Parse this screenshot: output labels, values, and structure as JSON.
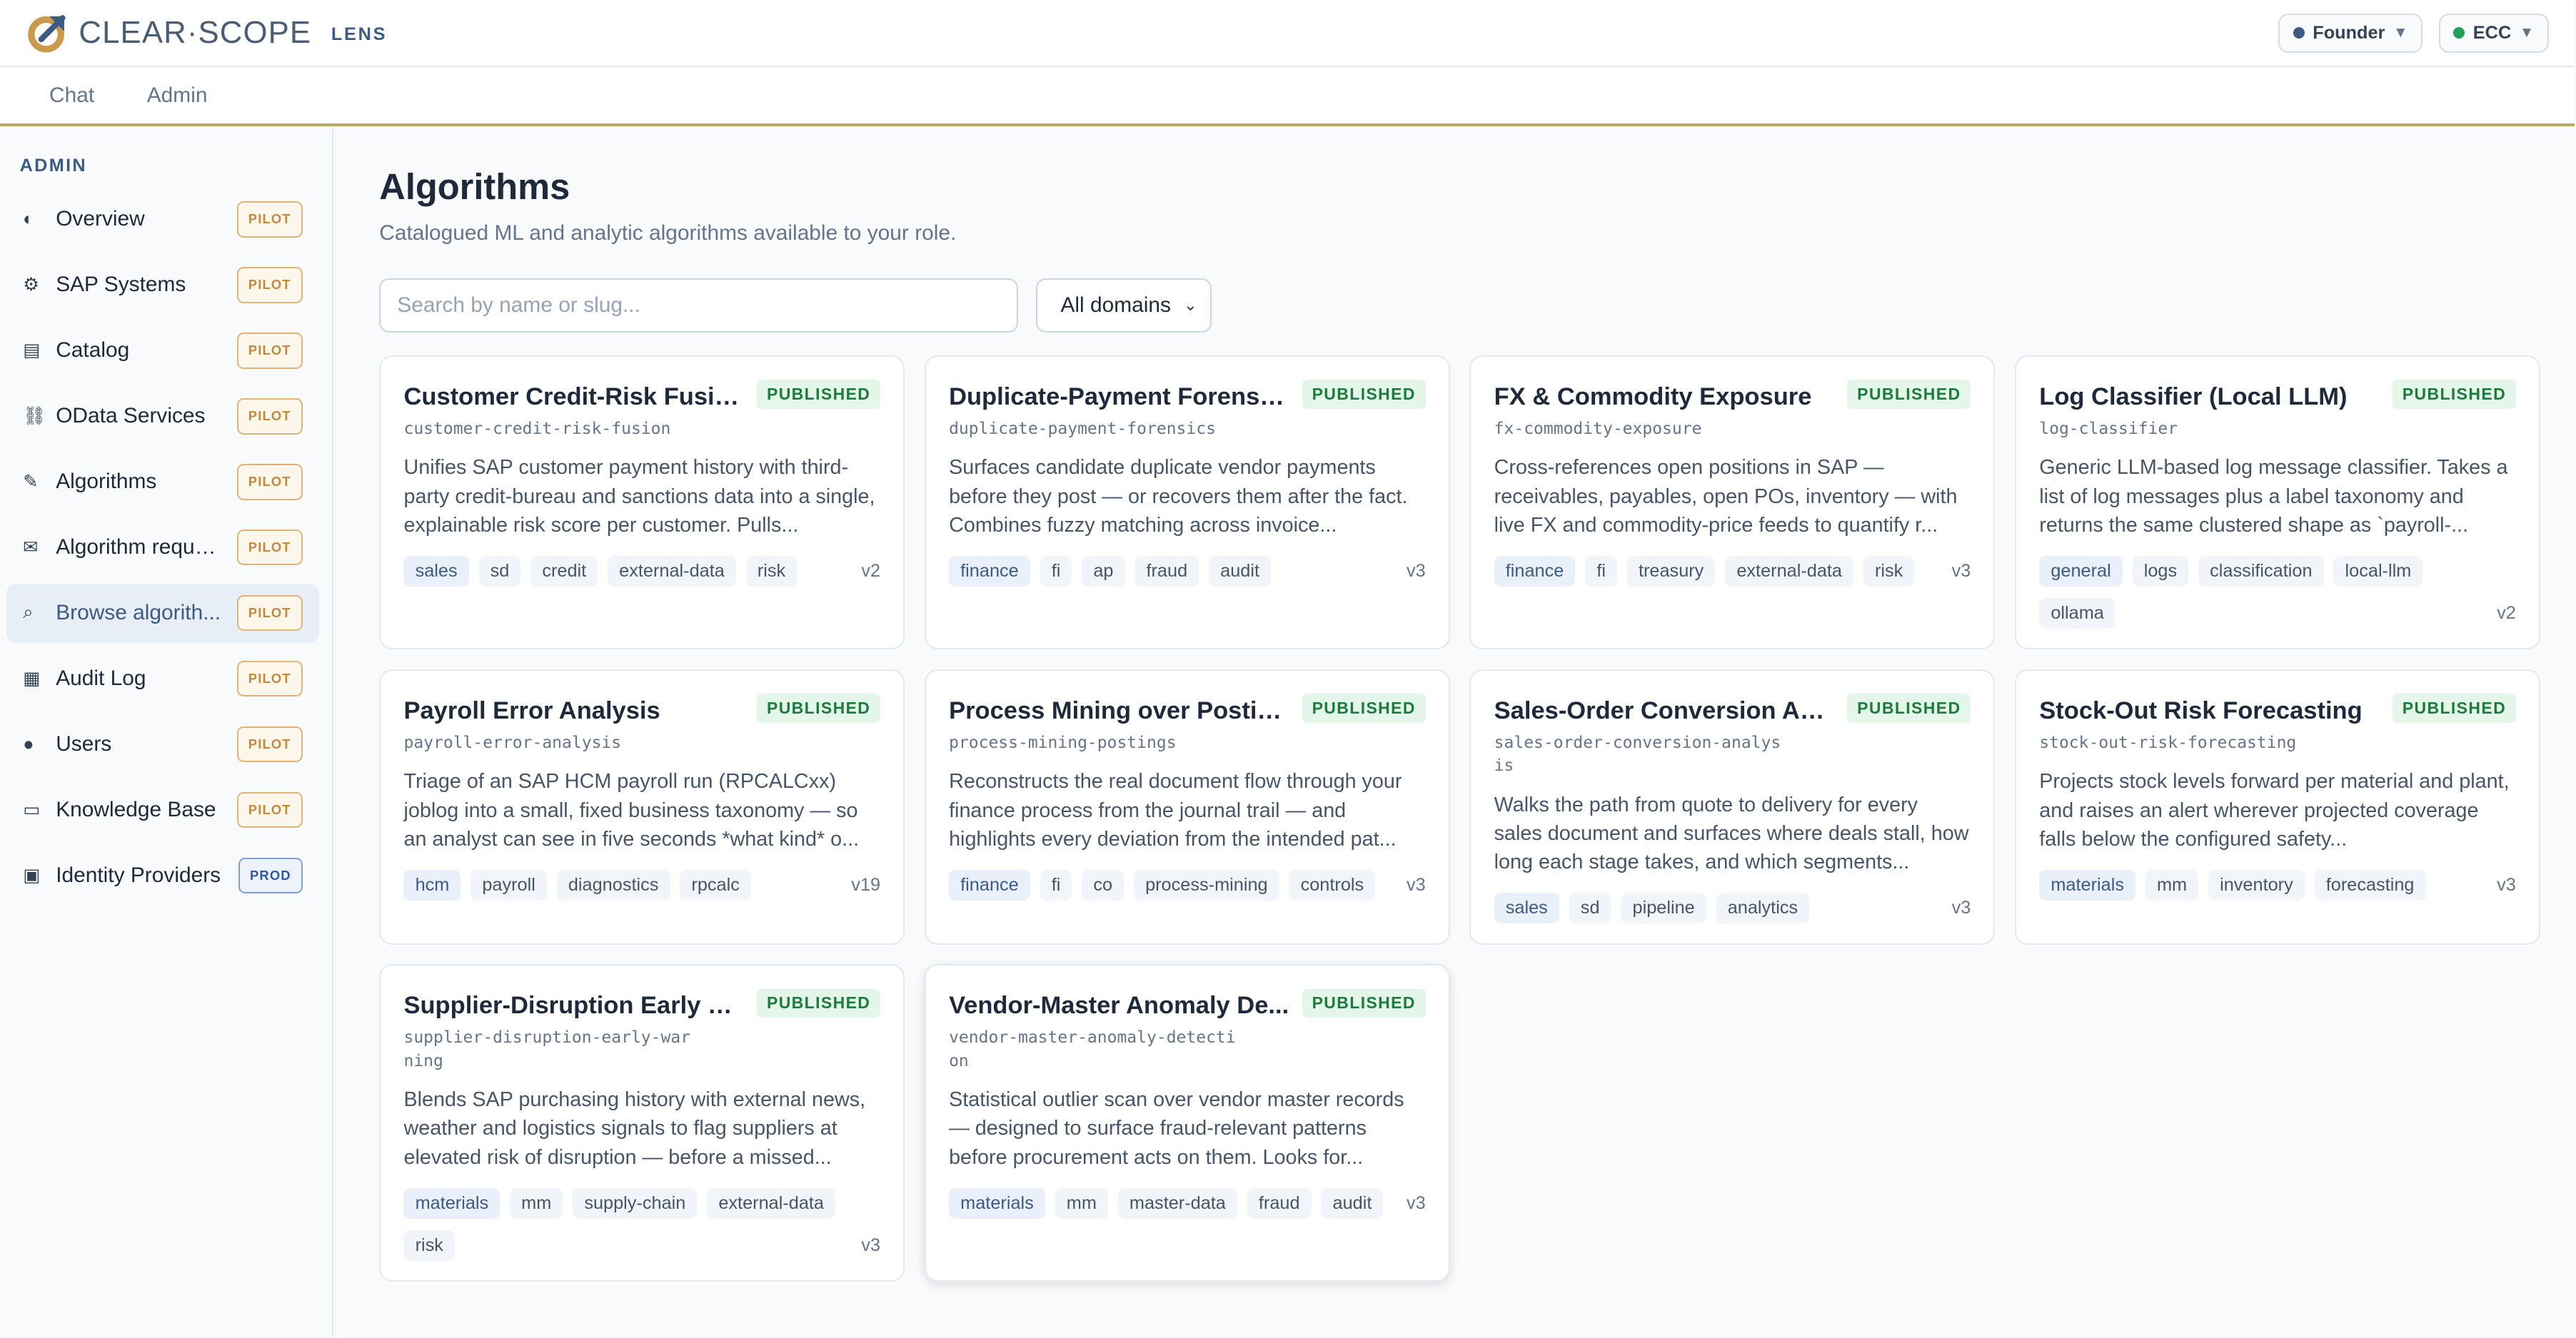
{
  "brand": {
    "name": "CLEAR·SCOPE",
    "product": "LENS"
  },
  "header": {
    "role": {
      "label": "Founder",
      "color": "#3b5b85"
    },
    "system": {
      "label": "ECC",
      "color": "#22a055"
    }
  },
  "topnav": {
    "items": [
      "Chat",
      "Admin"
    ]
  },
  "sidebar": {
    "heading": "ADMIN",
    "items": [
      {
        "label": "Overview",
        "icon": "half-circle-icon",
        "glyph": "◐",
        "badge": "PILOT"
      },
      {
        "label": "SAP Systems",
        "icon": "gear-icon",
        "glyph": "⚙",
        "badge": "PILOT"
      },
      {
        "label": "Catalog",
        "icon": "books-icon",
        "glyph": "▤",
        "badge": "PILOT"
      },
      {
        "label": "OData Services",
        "icon": "link-icon",
        "glyph": "⛓",
        "badge": "PILOT"
      },
      {
        "label": "Algorithms",
        "icon": "pencil-icon",
        "glyph": "✎",
        "badge": "PILOT"
      },
      {
        "label": "Algorithm reque...",
        "icon": "envelope-icon",
        "glyph": "✉",
        "badge": "PILOT"
      },
      {
        "label": "Browse algorith...",
        "icon": "magnifier-icon",
        "glyph": "⌕",
        "badge": "PILOT",
        "active": true
      },
      {
        "label": "Audit Log",
        "icon": "ledger-icon",
        "glyph": "▦",
        "badge": "PILOT"
      },
      {
        "label": "Users",
        "icon": "user-icon",
        "glyph": "●",
        "badge": "PILOT"
      },
      {
        "label": "Knowledge Base",
        "icon": "book-icon",
        "glyph": "▭",
        "badge": "PILOT"
      },
      {
        "label": "Identity Providers",
        "icon": "lock-icon",
        "glyph": "▣",
        "badge": "PROD"
      }
    ]
  },
  "page": {
    "title": "Algorithms",
    "subtitle": "Catalogued ML and analytic algorithms available to your role.",
    "search_placeholder": "Search by name or slug...",
    "domain_filter": "All domains"
  },
  "cards": [
    {
      "title": "Customer Credit-Risk Fusion",
      "status": "PUBLISHED",
      "slug": "customer-credit-risk-fusion",
      "description": "Unifies SAP customer payment history with third-party credit-bureau and sanctions data into a single, explainable risk score per customer. Pulls...",
      "tags": [
        "sales",
        "sd",
        "credit",
        "external-data",
        "risk"
      ],
      "version": "v2"
    },
    {
      "title": "Duplicate-Payment Forensics",
      "status": "PUBLISHED",
      "slug": "duplicate-payment-forensics",
      "description": "Surfaces candidate duplicate vendor payments before they post — or recovers them after the fact. Combines fuzzy matching across invoice...",
      "tags": [
        "finance",
        "fi",
        "ap",
        "fraud",
        "audit"
      ],
      "version": "v3"
    },
    {
      "title": "FX & Commodity Exposure",
      "status": "PUBLISHED",
      "slug": "fx-commodity-exposure",
      "description": "Cross-references open positions in SAP — receivables, payables, open POs, inventory — with live FX and commodity-price feeds to quantify r...",
      "tags": [
        "finance",
        "fi",
        "treasury",
        "external-data",
        "risk"
      ],
      "version": "v3"
    },
    {
      "title": "Log Classifier (Local LLM)",
      "status": "PUBLISHED",
      "slug": "log-classifier",
      "description": "Generic LLM-based log message classifier. Takes a list of log messages plus a label taxonomy and returns the same clustered shape as `payroll-...",
      "tags": [
        "general",
        "logs",
        "classification",
        "local-llm",
        "ollama"
      ],
      "version": "v2"
    },
    {
      "title": "Payroll Error Analysis",
      "status": "PUBLISHED",
      "slug": "payroll-error-analysis",
      "description": "Triage of an SAP HCM payroll run (RPCALCxx) joblog into a small, fixed business taxonomy — so an analyst can see in five seconds *what kind* o...",
      "tags": [
        "hcm",
        "payroll",
        "diagnostics",
        "rpcalc"
      ],
      "version": "v19"
    },
    {
      "title": "Process Mining over Postings",
      "status": "PUBLISHED",
      "slug": "process-mining-postings",
      "description": "Reconstructs the real document flow through your finance process from the journal trail — and highlights every deviation from the intended pat...",
      "tags": [
        "finance",
        "fi",
        "co",
        "process-mining",
        "controls"
      ],
      "version": "v3"
    },
    {
      "title": "Sales-Order Conversion An...",
      "status": "PUBLISHED",
      "slug": "sales-order-conversion-analysis",
      "description": "Walks the path from quote to delivery for every sales document and surfaces where deals stall, how long each stage takes, and which segments...",
      "tags": [
        "sales",
        "sd",
        "pipeline",
        "analytics"
      ],
      "version": "v3"
    },
    {
      "title": "Stock-Out Risk Forecasting",
      "status": "PUBLISHED",
      "slug": "stock-out-risk-forecasting",
      "description": "Projects stock levels forward per material and plant, and raises an alert wherever projected coverage falls below the configured safety...",
      "tags": [
        "materials",
        "mm",
        "inventory",
        "forecasting"
      ],
      "version": "v3"
    },
    {
      "title": "Supplier-Disruption Early W...",
      "status": "PUBLISHED",
      "slug": "supplier-disruption-early-warning",
      "description": "Blends SAP purchasing history with external news, weather and logistics signals to flag suppliers at elevated risk of disruption — before a missed...",
      "tags": [
        "materials",
        "mm",
        "supply-chain",
        "external-data",
        "risk"
      ],
      "version": "v3"
    },
    {
      "title": "Vendor-Master Anomaly De...",
      "status": "PUBLISHED",
      "slug": "vendor-master-anomaly-detection",
      "description": "Statistical outlier scan over vendor master records — designed to surface fraud-relevant patterns before procurement acts on them. Looks for...",
      "tags": [
        "materials",
        "mm",
        "master-data",
        "fraud",
        "audit"
      ],
      "version": "v3",
      "elevated": true
    }
  ]
}
